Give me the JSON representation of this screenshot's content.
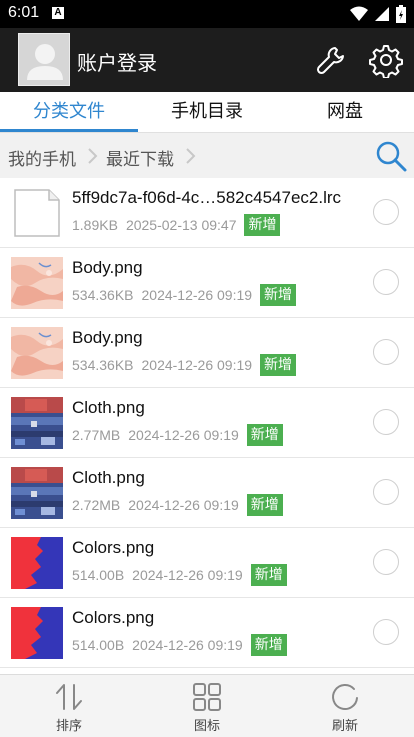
{
  "status_bar": {
    "time": "6:01",
    "notification_icon": "A"
  },
  "header": {
    "title": "账户登录"
  },
  "tabs": [
    {
      "label": "分类文件"
    },
    {
      "label": "手机目录"
    },
    {
      "label": "网盘"
    }
  ],
  "breadcrumb": {
    "items": [
      "我的手机",
      "最近下载"
    ]
  },
  "files": [
    {
      "name": "5ff9dc7a-f06d-4c…582c4547ec2.lrc",
      "size": "1.89KB",
      "date": "2025-02-13 09:47",
      "badge": "新增",
      "thumb": "file-icon"
    },
    {
      "name": "Body.png",
      "size": "534.36KB",
      "date": "2024-12-26 09:19",
      "badge": "新增",
      "thumb": "body-thumb"
    },
    {
      "name": "Body.png",
      "size": "534.36KB",
      "date": "2024-12-26 09:19",
      "badge": "新增",
      "thumb": "body-thumb"
    },
    {
      "name": "Cloth.png",
      "size": "2.77MB",
      "date": "2024-12-26 09:19",
      "badge": "新增",
      "thumb": "cloth-thumb"
    },
    {
      "name": "Cloth.png",
      "size": "2.72MB",
      "date": "2024-12-26 09:19",
      "badge": "新增",
      "thumb": "cloth-thumb"
    },
    {
      "name": "Colors.png",
      "size": "514.00B",
      "date": "2024-12-26 09:19",
      "badge": "新增",
      "thumb": "colors-thumb"
    },
    {
      "name": "Colors.png",
      "size": "514.00B",
      "date": "2024-12-26 09:19",
      "badge": "新增",
      "thumb": "colors-thumb"
    }
  ],
  "bottom_bar": [
    {
      "label": "排序",
      "icon": "sort-icon"
    },
    {
      "label": "图标",
      "icon": "grid-icon"
    },
    {
      "label": "刷新",
      "icon": "refresh-icon"
    }
  ],
  "colors": {
    "accent": "#2f86cf",
    "badge": "#4caf50",
    "header_bg": "#1d1d1d"
  }
}
